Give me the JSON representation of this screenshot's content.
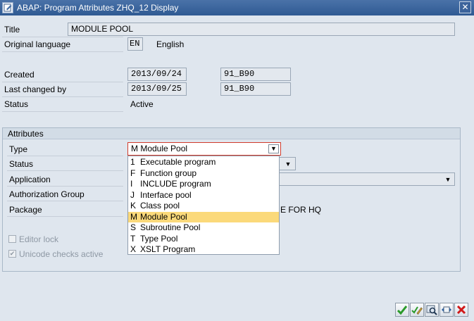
{
  "window": {
    "title": "ABAP: Program Attributes ZHQ_12 Display",
    "close_glyph": "✕"
  },
  "header": {
    "title_label": "Title",
    "title_value": "MODULE POOL",
    "orig_lang_label": "Original language",
    "orig_lang_code": "EN",
    "orig_lang_name": "English",
    "created_label": "Created",
    "created_date": "2013/09/24",
    "created_by": "91_B90",
    "changed_label": "Last changed by",
    "changed_date": "2013/09/25",
    "changed_by": "91_B90",
    "status_label": "Status",
    "status_value": "Active"
  },
  "attributes": {
    "group_title": "Attributes",
    "type_label": "Type",
    "type_value": "M Module Pool",
    "status_label": "Status",
    "application_label": "Application",
    "auth_group_label": "Authorization Group",
    "package_label": "Package",
    "package_value_partial": "E FOR HQ",
    "editor_lock_label": "Editor lock",
    "editor_lock_checked": false,
    "unicode_label": "Unicode checks active",
    "unicode_checked": true
  },
  "type_dropdown": {
    "items": [
      {
        "key": "1",
        "text": "Executable program"
      },
      {
        "key": "F",
        "text": "Function group"
      },
      {
        "key": "I",
        "text": "INCLUDE program"
      },
      {
        "key": "J",
        "text": "Interface pool"
      },
      {
        "key": "K",
        "text": "Class pool"
      },
      {
        "key": "M",
        "text": "Module Pool"
      },
      {
        "key": "S",
        "text": "Subroutine Pool"
      },
      {
        "key": "T",
        "text": "Type Pool"
      },
      {
        "key": "X",
        "text": "XSLT Program"
      }
    ],
    "selected_key": "M"
  },
  "toolbar": {
    "buttons": [
      "confirm-icon",
      "edit-icon",
      "search-icon",
      "switch-icon",
      "cancel-icon"
    ]
  },
  "colors": {
    "title_bar": "#2f5a93",
    "selected_item": "#fbd97a",
    "focus_border": "#d23b2b",
    "cancel_red": "#d01818",
    "confirm_green": "#2a9a2a"
  }
}
